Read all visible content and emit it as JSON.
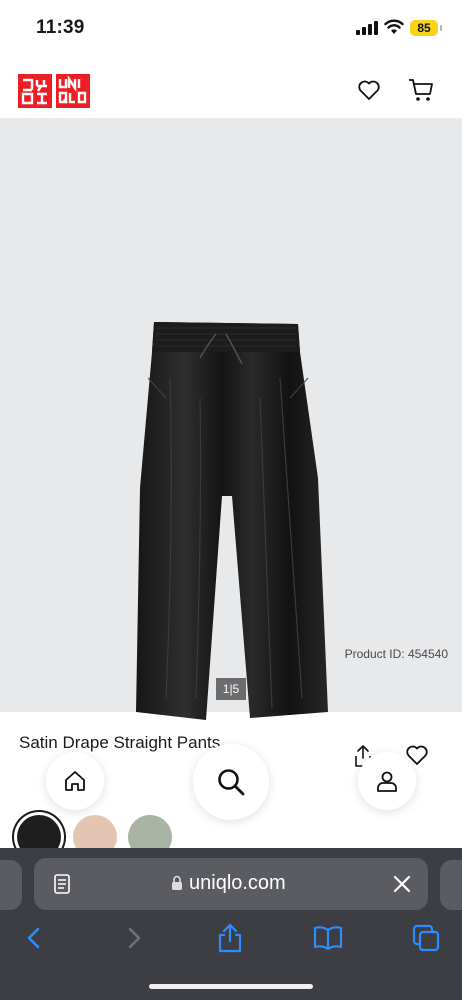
{
  "status": {
    "time": "11:39",
    "battery": "85"
  },
  "header": {
    "logo_top": "UNI QLO",
    "logo_bottom": "UNI QLO"
  },
  "hero": {
    "product_id": "Product ID: 454540",
    "counter": "1|5"
  },
  "product": {
    "title": "Satin Drape Straight Pants"
  },
  "swatches": [
    {
      "name": "black",
      "color": "#1e1e1e",
      "selected": true
    },
    {
      "name": "beige",
      "color": "#e2c6b3",
      "selected": false
    },
    {
      "name": "green",
      "color": "#a9b4a5",
      "selected": false
    }
  ],
  "browser": {
    "url": "uniqlo.com"
  },
  "colors": {
    "brand": "#ed1d24",
    "browser_bar": "#3c3e43",
    "ios_blue": "#2f8cff"
  },
  "icons": [
    "signal-icon",
    "wifi-icon",
    "heart-icon",
    "cart-icon",
    "share-icon",
    "home-icon",
    "search-icon",
    "account-icon",
    "reader-icon",
    "lock-icon",
    "close-icon",
    "back-icon",
    "forward-icon",
    "bookmarks-icon",
    "tabs-icon"
  ]
}
